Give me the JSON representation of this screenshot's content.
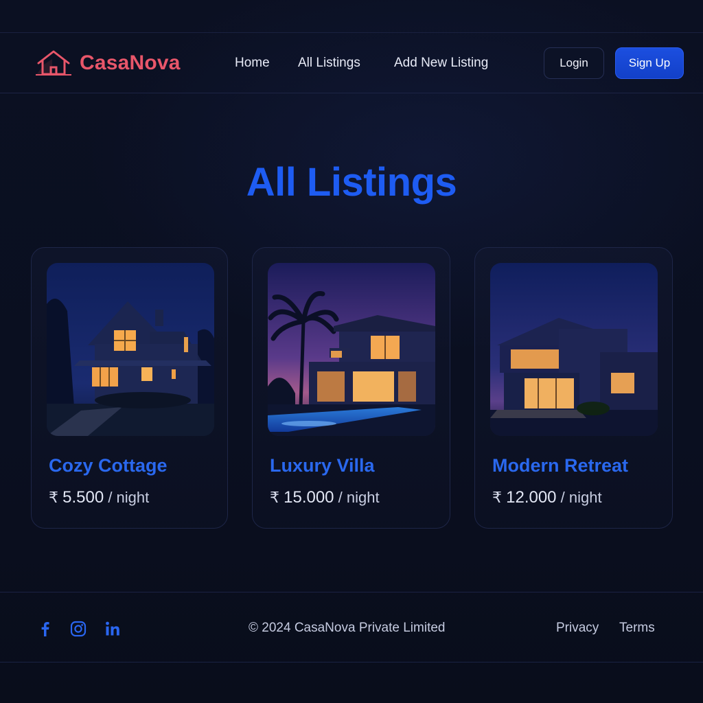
{
  "brand": {
    "name": "CasaNova",
    "icon": "house-icon",
    "color": "#e8566a"
  },
  "nav": {
    "links": [
      {
        "label": "Home"
      },
      {
        "label": "All Listings"
      },
      {
        "label": "Add New Listing"
      }
    ],
    "login_label": "Login",
    "signup_label": "Sign Up"
  },
  "main": {
    "title": "All Listings",
    "listings": [
      {
        "title": "Cozy Cottage",
        "currency": "₹",
        "price": "5.500",
        "unit": "/ night",
        "image": "cottage-night-image"
      },
      {
        "title": "Luxury Villa",
        "currency": "₹",
        "price": "15.000",
        "unit": "/ night",
        "image": "villa-pool-night-image"
      },
      {
        "title": "Modern Retreat",
        "currency": "₹",
        "price": "12.000",
        "unit": "/ night",
        "image": "modern-house-night-image"
      }
    ]
  },
  "footer": {
    "social": [
      "facebook-icon",
      "instagram-icon",
      "linkedin-icon"
    ],
    "copyright": "© 2024 CasaNova Private Limited",
    "links": [
      {
        "label": "Privacy"
      },
      {
        "label": "Terms"
      }
    ]
  },
  "colors": {
    "accent": "#1e5cf2",
    "background": "#0a0f1f",
    "brand": "#e8566a"
  }
}
